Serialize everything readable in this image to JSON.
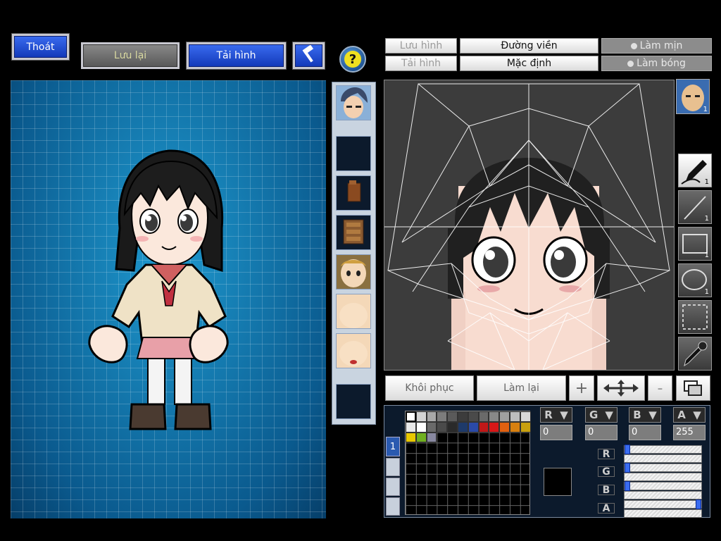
{
  "top_bar": {
    "exit_label": "Thoát",
    "save_label": "Lưu lại",
    "load_label": "Tải hình"
  },
  "editor_toolbar": {
    "save_image_label": "Lưu hình",
    "load_image_label": "Tải hình",
    "outline_label": "Đường viền",
    "default_label": "Mặc định",
    "smooth_label": "Làm mịn",
    "shine_label": "Làm bóng"
  },
  "face_selector": {
    "badge": "1"
  },
  "tools": [
    {
      "name": "pen-tool",
      "count": "1",
      "active": true
    },
    {
      "name": "line-tool",
      "count": "1"
    },
    {
      "name": "rectangle-tool",
      "count": "1"
    },
    {
      "name": "ellipse-tool",
      "count": "1"
    },
    {
      "name": "select-tool",
      "count": ""
    },
    {
      "name": "eyedropper-tool",
      "count": ""
    }
  ],
  "canvas_actions": {
    "restore_label": "Khôi phục",
    "redo_label": "Làm lại",
    "zoom_in": "+",
    "zoom_out": "-"
  },
  "palette": {
    "tab_label": "1",
    "row1": [
      "#ffffff",
      "#d4d4d4",
      "#a8a8a8",
      "#7c7c7c",
      "#5a5a5a",
      "#3c3c3c",
      "#4a4a4a",
      "#6a6a6a",
      "#888888",
      "#a0a0a0",
      "#bdbdbd",
      "#d8d8d8"
    ],
    "row2": [
      "#e8e8e8",
      "#ffffff",
      "#6a6a6a",
      "#4a4a4a",
      "#2a2a2a",
      "#1e3a6a",
      "#2a4aa8",
      "#c01818",
      "#d81818",
      "#e06010",
      "#d88010",
      "#c8a010"
    ],
    "row3": [
      "#e8c800",
      "#70b020",
      "#8888a0"
    ]
  },
  "color": {
    "r_label": "R",
    "g_label": "G",
    "b_label": "B",
    "a_label": "A",
    "r": "0",
    "g": "0",
    "b": "0",
    "a": "255",
    "current_color": "#000000"
  },
  "preview": {
    "grid_color": "#0e6aa0"
  }
}
